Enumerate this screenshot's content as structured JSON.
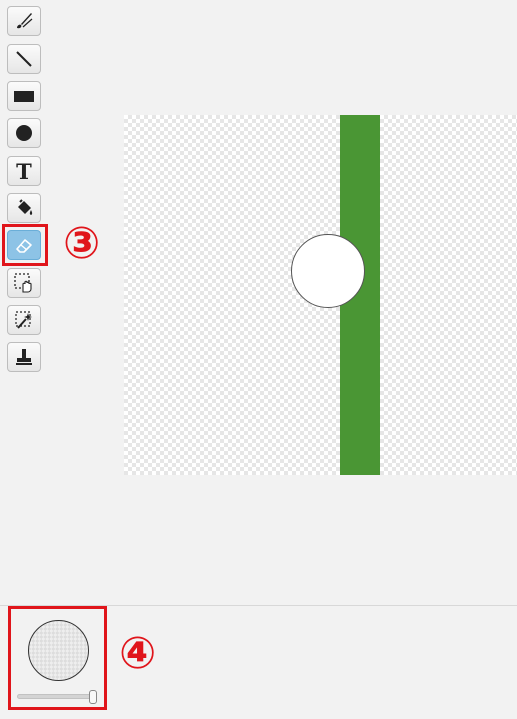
{
  "toolbar": {
    "tools": [
      {
        "name": "brush-tool",
        "icon": "paintbrush-icon"
      },
      {
        "name": "line-tool",
        "icon": "line-icon"
      },
      {
        "name": "rectangle-tool",
        "icon": "rectangle-icon"
      },
      {
        "name": "ellipse-tool",
        "icon": "circle-icon"
      },
      {
        "name": "text-tool",
        "icon": "text-icon"
      },
      {
        "name": "fill-tool",
        "icon": "paint-bucket-icon"
      },
      {
        "name": "eraser-tool",
        "icon": "eraser-icon",
        "selected": true
      },
      {
        "name": "select-tool",
        "icon": "select-hand-icon"
      },
      {
        "name": "magic-select-tool",
        "icon": "magic-wand-icon"
      },
      {
        "name": "stamp-tool",
        "icon": "stamp-icon"
      }
    ],
    "text_tool_glyph": "T"
  },
  "annotations": {
    "step3": "③",
    "step4": "④"
  },
  "canvas": {
    "shape_color": "#4a9634",
    "annotation_color": "#e0151b"
  },
  "brush": {
    "size_fraction": 1.0
  }
}
